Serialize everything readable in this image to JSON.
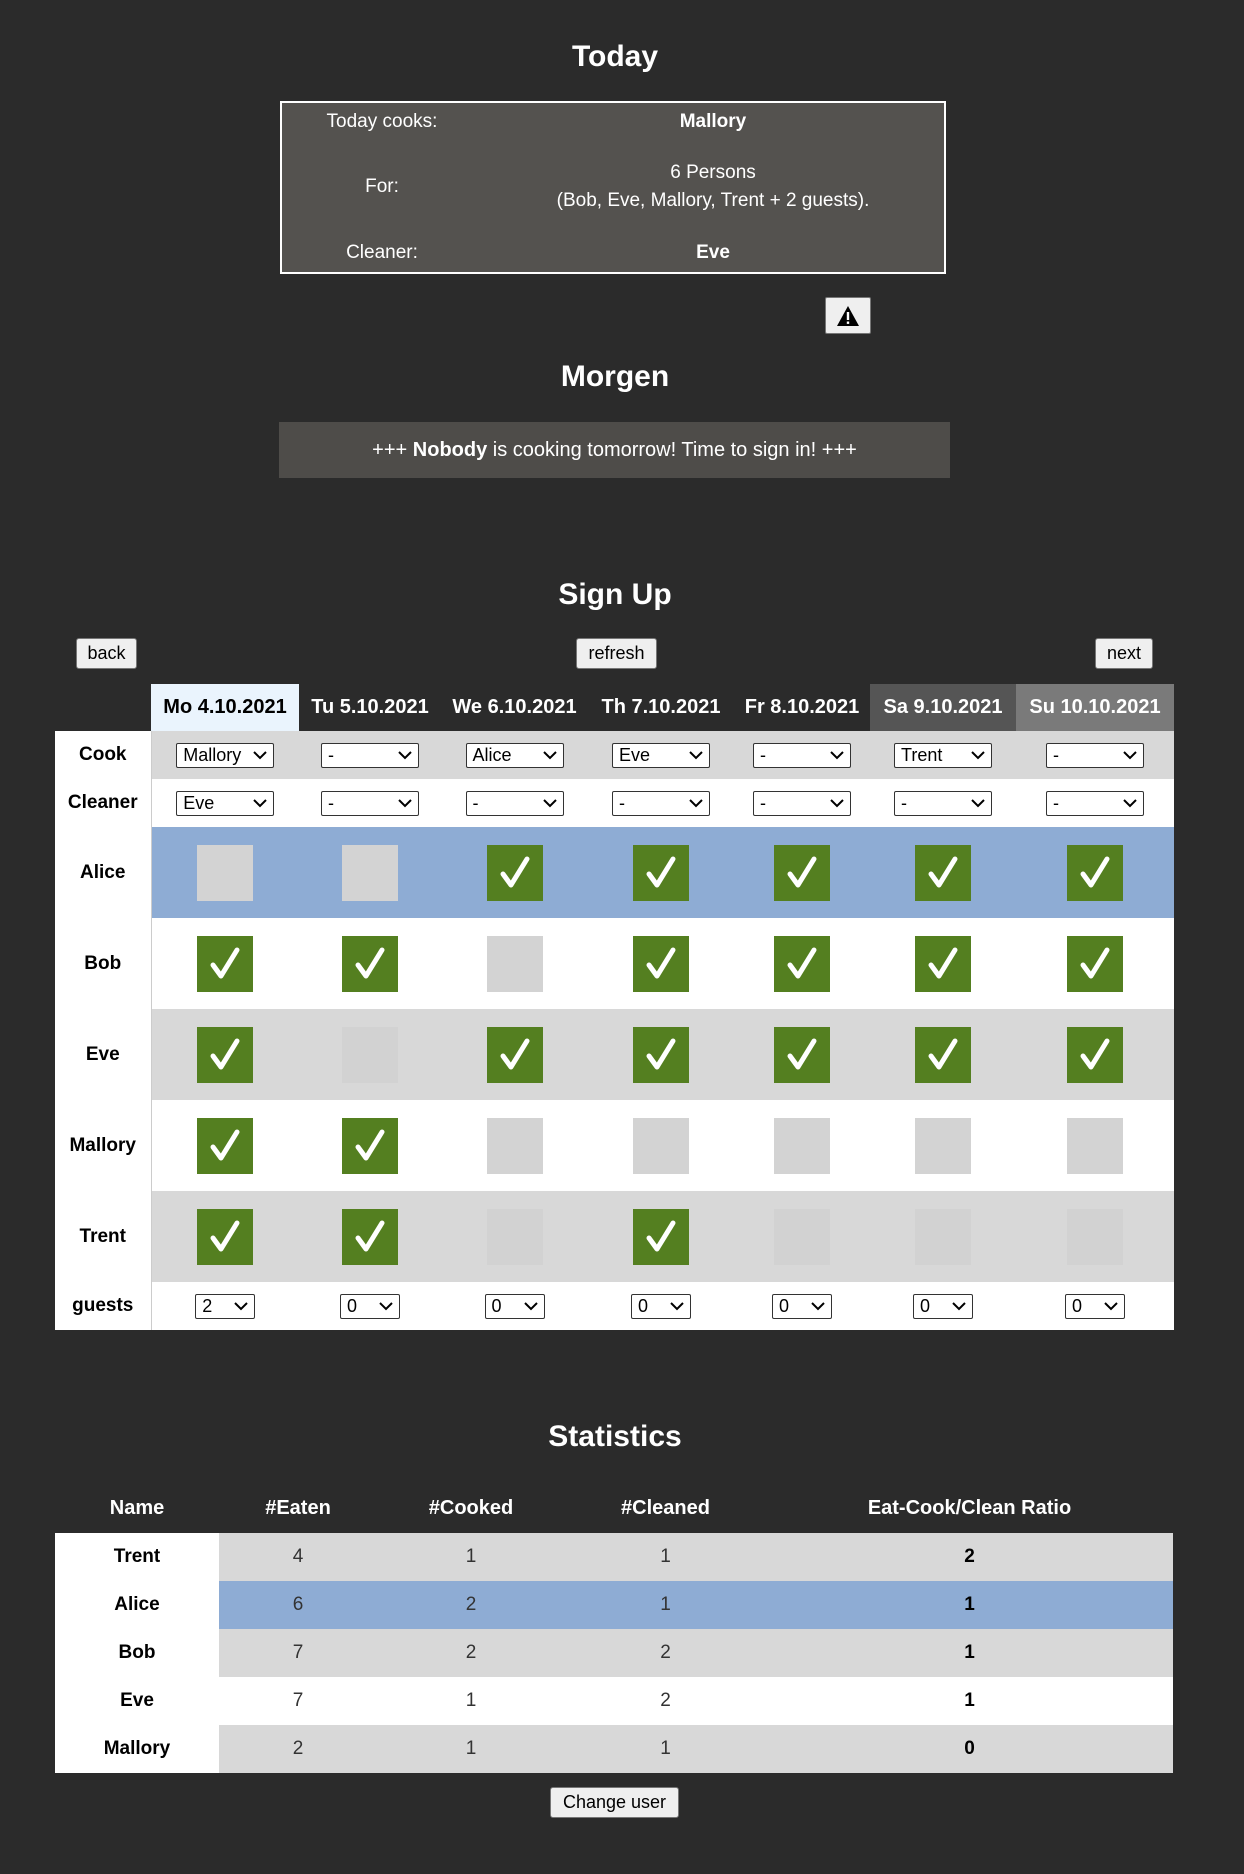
{
  "today": {
    "heading": "Today",
    "cooks_label": "Today cooks:",
    "cook": "Mallory",
    "for_label": "For:",
    "persons": "6 Persons",
    "persons_detail": "(Bob, Eve, Mallory, Trent + 2 guests).",
    "cleaner_label": "Cleaner:",
    "cleaner": "Eve",
    "warning_icon": "warning-icon"
  },
  "tomorrow": {
    "heading": "Morgen",
    "prefix": "+++ ",
    "nobody": "Nobody",
    "suffix": " is cooking tomorrow! Time to sign in! +++"
  },
  "signup": {
    "heading": "Sign Up",
    "back_label": "back",
    "refresh_label": "refresh",
    "next_label": "next",
    "days": [
      "Mo 4.10.2021",
      "Tu 5.10.2021",
      "We 6.10.2021",
      "Th 7.10.2021",
      "Fr 8.10.2021",
      "Sa 9.10.2021",
      "Su 10.10.2021"
    ],
    "cook_label": "Cook",
    "cooks": [
      "Mallory",
      "-",
      "Alice",
      "Eve",
      "-",
      "Trent",
      "-"
    ],
    "cleaner_label": "Cleaner",
    "cleaners": [
      "Eve",
      "-",
      "-",
      "-",
      "-",
      "-",
      "-"
    ],
    "people": [
      {
        "name": "Alice",
        "checks": [
          false,
          false,
          true,
          true,
          true,
          true,
          true
        ]
      },
      {
        "name": "Bob",
        "checks": [
          true,
          true,
          false,
          true,
          true,
          true,
          true
        ]
      },
      {
        "name": "Eve",
        "checks": [
          true,
          false,
          true,
          true,
          true,
          true,
          true
        ]
      },
      {
        "name": "Mallory",
        "checks": [
          true,
          true,
          false,
          false,
          false,
          false,
          false
        ]
      },
      {
        "name": "Trent",
        "checks": [
          true,
          true,
          false,
          true,
          false,
          false,
          false
        ]
      }
    ],
    "guests_label": "guests",
    "guests": [
      "2",
      "0",
      "0",
      "0",
      "0",
      "0",
      "0"
    ]
  },
  "statistics": {
    "heading": "Statistics",
    "columns": [
      "Name",
      "#Eaten",
      "#Cooked",
      "#Cleaned",
      "Eat-Cook/Clean Ratio"
    ],
    "rows": [
      {
        "name": "Trent",
        "eaten": "4",
        "cooked": "1",
        "cleaned": "1",
        "ratio": "2"
      },
      {
        "name": "Alice",
        "eaten": "6",
        "cooked": "2",
        "cleaned": "1",
        "ratio": "1"
      },
      {
        "name": "Bob",
        "eaten": "7",
        "cooked": "2",
        "cleaned": "2",
        "ratio": "1"
      },
      {
        "name": "Eve",
        "eaten": "7",
        "cooked": "1",
        "cleaned": "2",
        "ratio": "1"
      },
      {
        "name": "Mallory",
        "eaten": "2",
        "cooked": "1",
        "cleaned": "1",
        "ratio": "0"
      }
    ],
    "change_user_label": "Change user"
  },
  "colors": {
    "background": "#2b2b2b",
    "checked": "#547f20",
    "unchecked": "#d3d3d3",
    "highlight": "#8eacd4"
  }
}
